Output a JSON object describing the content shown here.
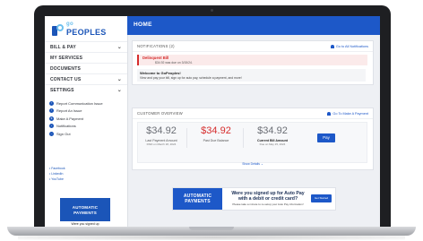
{
  "brand": {
    "logo_top": "go",
    "logo_text": "PEOPLES"
  },
  "nav": [
    {
      "label": "BILL & PAY",
      "chevron": true
    },
    {
      "label": "MY SERVICES",
      "chevron": false
    },
    {
      "label": "DOCUMENTS",
      "chevron": false
    },
    {
      "label": "CONTACT US",
      "chevron": true
    },
    {
      "label": "SETTINGS",
      "chevron": true
    }
  ],
  "quick_links": [
    {
      "label": "Report Communication Issue"
    },
    {
      "label": "Report An Issue"
    },
    {
      "label": "Make A Payment"
    },
    {
      "label": "Notifications"
    },
    {
      "label": "Sign Out"
    }
  ],
  "social_links": [
    "Facebook",
    "LinkedIn",
    "YouTube"
  ],
  "side_ad": {
    "title_line1": "AUTOMATIC",
    "title_line2": "PAYMENTS",
    "footer": "Were you signed up"
  },
  "header": {
    "title": "HOME"
  },
  "notifications": {
    "title": "NOTIFICATIONS (2)",
    "link": "Go to All Notifications",
    "alert_label": "Delinquent Bill",
    "alert_text": "$34.92 was due on 3/15/24.",
    "welcome_title": "Welcome to GoPeoples!",
    "welcome_text": "View and pay your bill, sign up for auto pay, schedule a payment, and more!"
  },
  "overview": {
    "title": "CUSTOMER OVERVIEW",
    "link": "Go To Make A Payment",
    "last_payment": {
      "amount": "$34.92",
      "label": "Last Payment Amount",
      "sub": "PAID on March 18, 2024"
    },
    "past_due": {
      "amount": "$34.92",
      "label": "Past Due Balance"
    },
    "current_bill": {
      "amount": "$34.92",
      "label": "Current Bill Amount",
      "sub": "Due on May 15, 2024"
    },
    "pay_label": "Pay",
    "view_more": "Show Details"
  },
  "banner": {
    "left_line1": "AUTOMATIC",
    "left_line2": "PAYMENTS",
    "title": "Were you signed up for Auto Pay with a debit or credit card?",
    "sub": "Please take a minute to re-setup your Auto Pay information!",
    "button": "Get Started"
  },
  "colors": {
    "primary": "#1d58c8",
    "alert": "#d62d2d",
    "accent": "#6ec0ee"
  }
}
